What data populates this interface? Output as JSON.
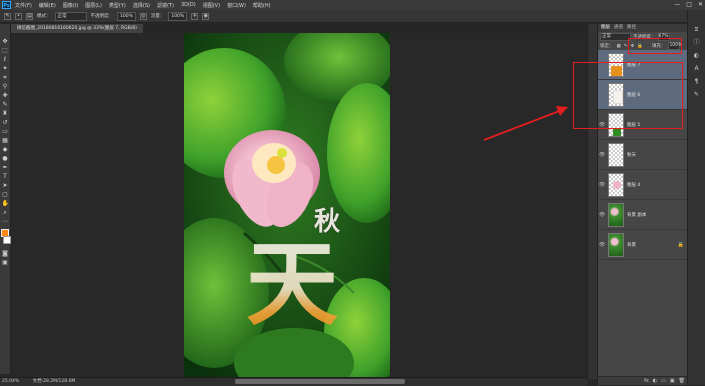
{
  "app": {
    "logo": "Ps",
    "menu": [
      "文件(F)",
      "编辑(E)",
      "图像(I)",
      "图层(L)",
      "类型(Y)",
      "选择(S)",
      "滤镜(T)",
      "3D(D)",
      "视图(V)",
      "窗口(W)",
      "帮助(H)"
    ],
    "window_controls": [
      "—",
      "□",
      "✕"
    ]
  },
  "options_bar": {
    "mode_label": "模式：",
    "mode_value": "正常",
    "opacity_label": "不透明度：",
    "opacity_value": "100%",
    "flow_label": "流量：",
    "flow_value": "100%"
  },
  "document": {
    "tab_title": "微信截图_20180816160620.jpg @ 33%(图层 7, RGB/8)",
    "canvas_text": [
      "秋",
      "天"
    ],
    "zoom": "25.04%",
    "doc_info": "文档:28.2M/128.6M"
  },
  "layers_panel": {
    "tabs": [
      "图层",
      "通道",
      "路径"
    ],
    "blend_mode": "正常",
    "opacity_label": "不透明度：",
    "opacity_value": "67%",
    "lock_label": "锁定：",
    "fill_label": "填充：",
    "fill_value": "100%",
    "layers": [
      {
        "name": "图层 7",
        "selected": true,
        "visible": false
      },
      {
        "name": "图层 6",
        "selected": true,
        "visible": false
      },
      {
        "name": "图层 5",
        "selected": false,
        "visible": true
      },
      {
        "name": "秋天",
        "selected": false,
        "visible": true
      },
      {
        "name": "图层 4",
        "selected": false,
        "visible": true
      },
      {
        "name": "背景 副本",
        "selected": false,
        "visible": true
      },
      {
        "name": "背景",
        "selected": false,
        "visible": true
      }
    ],
    "bottom_icons": [
      "fx",
      "◐",
      "▭",
      "▣",
      "🗑"
    ]
  },
  "colors": {
    "foreground": "#ff8b15",
    "background": "#ffffff",
    "annotation": "#e31e1e"
  }
}
